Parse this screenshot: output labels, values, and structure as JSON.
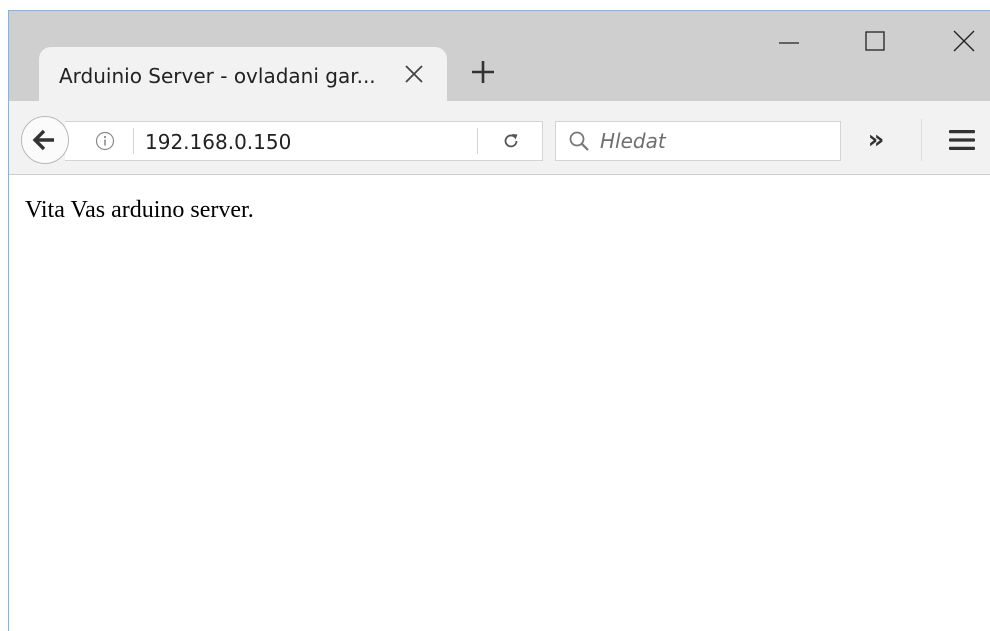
{
  "tab": {
    "title": "Arduinio Server - ovladani gar...",
    "close_icon": "close-icon"
  },
  "new_tab_icon": "plus-icon",
  "window_controls": {
    "minimize_icon": "minimize-icon",
    "maximize_icon": "maximize-icon",
    "close_icon": "close-icon"
  },
  "toolbar": {
    "back_icon": "back-arrow-icon",
    "info_icon": "info-icon",
    "url": "192.168.0.150",
    "reload_icon": "reload-icon",
    "search_icon": "search-icon",
    "search_placeholder": "Hledat",
    "overflow_label": "»",
    "menu_icon": "hamburger-menu-icon"
  },
  "page": {
    "text": "Vita Vas arduino server."
  },
  "colors": {
    "titlebar": "#cfcfcf",
    "toolbar": "#f2f2f2",
    "window_border": "#8fb1cf"
  }
}
